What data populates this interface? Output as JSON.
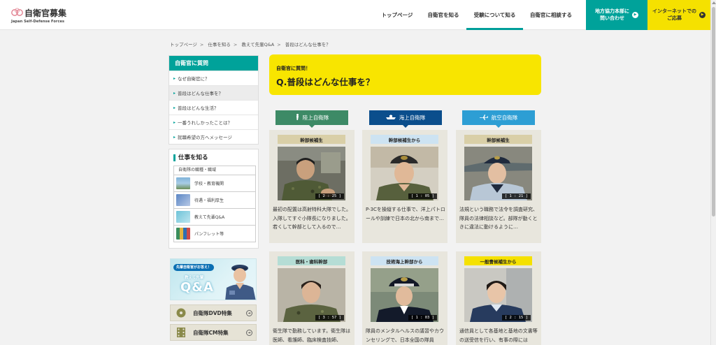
{
  "header": {
    "logo_title": "自衛官募集",
    "logo_sub": "Japan Self-Defense Forces",
    "nav": [
      {
        "label": "トップページ"
      },
      {
        "label": "自衛官を知る"
      },
      {
        "label": "受験について知る"
      },
      {
        "label": "自衛官に相談する"
      }
    ],
    "btn_office": "地方協力本部に\n問い合わせ",
    "btn_apply": "インターネットでの\nご応募"
  },
  "breadcrumb": [
    "トップページ",
    "仕事を知る",
    "教えて先輩Q&A",
    "普段はどんな仕事を？"
  ],
  "sidebar": {
    "question_head": "自衛官に質問",
    "questions": [
      {
        "label": "なぜ自衛官に？"
      },
      {
        "label": "普段はどんな仕事を？"
      },
      {
        "label": "普段はどんな生活？"
      },
      {
        "label": "一番うれしかったことは？"
      },
      {
        "label": "就職希望の方へメッセージ"
      }
    ],
    "work_head": "仕事を知る",
    "work_sub": "自衛隊の職種・職域",
    "work_items": [
      {
        "label": "学校・教育機関"
      },
      {
        "label": "待遇・福利厚生"
      },
      {
        "label": "教えて先輩Q&A"
      },
      {
        "label": "パンフレット等"
      }
    ],
    "banner": {
      "bubble": "先輩自衛官がお答え！",
      "mid": "教えて先輩",
      "qa": "Q&A"
    },
    "dvd_label": "自衛隊DVD特集",
    "cm_label": "自衛隊CM特集"
  },
  "question": {
    "category": "自衛官に質問！",
    "title": "Q.普段はどんな仕事を？"
  },
  "columns": [
    {
      "label": "陸上自衛隊",
      "icon": "soldier-icon"
    },
    {
      "label": "海上自衛隊",
      "icon": "ship-icon"
    },
    {
      "label": "航空自衛隊",
      "icon": "plane-icon"
    }
  ],
  "cards": [
    {
      "label": "幹部候補生",
      "duration": "[ 2 : 25 ]",
      "desc": "最初の配置は高射特科大隊でした。入隊してすぐ小隊長になりました。若くして幹部として入るので…"
    },
    {
      "label": "幹部候補生から",
      "duration": "[ 1 : 05 ]",
      "desc": "P-3Cを操縦する仕事で、洋上パトロールや訓練で日本の北から南まで…"
    },
    {
      "label": "幹部候補生",
      "duration": "[ 1 : 21 ]",
      "desc": "法規という職務で法令を調査研究、隊員の法律相談など。部隊が動くときに違法に動けるように…"
    },
    {
      "label": "医科・歯科幹部",
      "duration": "[ 3 : 57 ]",
      "desc": "衛生隊で勤務しています。衛生隊は医師、看護師、臨床検査技師、"
    },
    {
      "label": "技術海上幹部から",
      "duration": "[ 1 : 03 ]",
      "desc": "隊員のメンタルヘルスの議習やカウンセリングで、日本全国の隊員"
    },
    {
      "label": "一般曹候補生から",
      "duration": "[ 2 : 15 ]",
      "desc": "通信員として各基地と基地の文書等の送受信を行い、有事の際には"
    }
  ],
  "colors": {
    "teal": "#00a29a",
    "yellow": "#f8e500",
    "army": "#3d8a66",
    "navy": "#0b4e8c",
    "air": "#2d9ed4",
    "label_army": "#d9cfa7",
    "label_navy": "#cde3f2",
    "label_medical": "#b5ddd5",
    "label_air_enlisted": "#f5e100"
  }
}
